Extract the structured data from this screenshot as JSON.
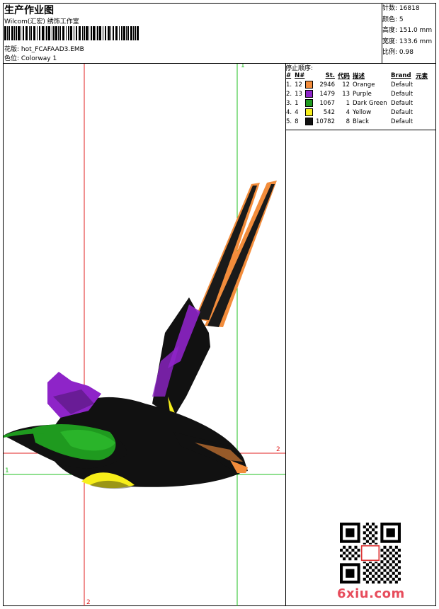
{
  "header": {
    "title": "生产作业图",
    "company": "Wilcom(汇宏) 绣饰工作室",
    "design_label": "花版:",
    "design_value": "hot_FCAFAAD3.EMB",
    "colorway_label": "色位:",
    "colorway_value": "Colorway 1"
  },
  "stats": {
    "stitches_label": "针数:",
    "stitches": "16818",
    "colors_label": "颜色:",
    "colors": "5",
    "height_label": "高度:",
    "height": "151.0 mm",
    "width_label": "宽度:",
    "width": "133.6 mm",
    "scale_label": "比例:",
    "scale": "0.98"
  },
  "stop_sequence": {
    "title": "停止顺序:",
    "headers": [
      "#",
      "N#",
      "St.",
      "代码",
      "描述",
      "Brand",
      "元素"
    ],
    "rows": [
      {
        "idx": "1.",
        "n": "12",
        "color": "#f28c3b",
        "st": "2946",
        "code": "12",
        "desc": "Orange",
        "brand": "Default"
      },
      {
        "idx": "2.",
        "n": "13",
        "color": "#8e24c8",
        "st": "1479",
        "code": "13",
        "desc": "Purple",
        "brand": "Default"
      },
      {
        "idx": "3.",
        "n": "1",
        "color": "#1f9a1f",
        "st": "1067",
        "code": "1",
        "desc": "Dark Green",
        "brand": "Default"
      },
      {
        "idx": "4.",
        "n": "4",
        "color": "#f7ef1a",
        "st": "542",
        "code": "4",
        "desc": "Yellow",
        "brand": "Default"
      },
      {
        "idx": "5.",
        "n": "8",
        "color": "#111111",
        "st": "10782",
        "code": "8",
        "desc": "Black",
        "brand": "Default"
      }
    ]
  },
  "axes": {
    "top_label": "1",
    "right_label": "2",
    "left_label": "1",
    "bottom_label": "2"
  },
  "watermark": {
    "site": "6xiu.com"
  }
}
